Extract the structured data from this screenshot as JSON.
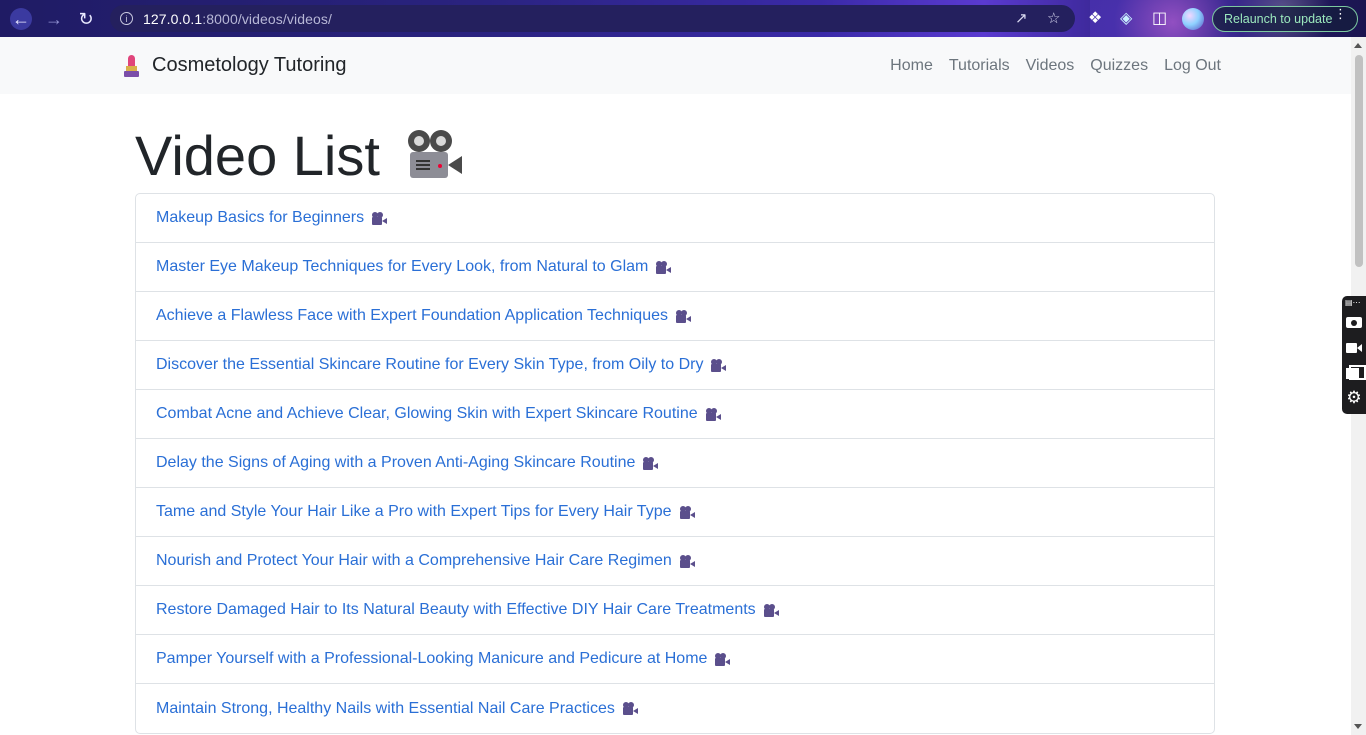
{
  "browser": {
    "url_host": "127.0.0.1",
    "url_path": ":8000/videos/videos/",
    "relaunch_label": "Relaunch to update"
  },
  "site": {
    "brand": "Cosmetology Tutoring",
    "nav": [
      "Home",
      "Tutorials",
      "Videos",
      "Quizzes",
      "Log Out"
    ]
  },
  "page": {
    "title": "Video List"
  },
  "videos": [
    "Makeup Basics for Beginners",
    "Master Eye Makeup Techniques for Every Look, from Natural to Glam",
    "Achieve a Flawless Face with Expert Foundation Application Techniques",
    "Discover the Essential Skincare Routine for Every Skin Type, from Oily to Dry",
    "Combat Acne and Achieve Clear, Glowing Skin with Expert Skincare Routine",
    "Delay the Signs of Aging with a Proven Anti-Aging Skincare Routine",
    "Tame and Style Your Hair Like a Pro with Expert Tips for Every Hair Type",
    "Nourish and Protect Your Hair with a Comprehensive Hair Care Regimen",
    "Restore Damaged Hair to Its Natural Beauty with Effective DIY Hair Care Treatments",
    "Pamper Yourself with a Professional-Looking Manicure and Pedicure at Home",
    "Maintain Strong, Healthy Nails with Essential Nail Care Practices"
  ],
  "colors": {
    "link": "#2a6fd6",
    "navbar_bg": "#f8f9fa"
  }
}
